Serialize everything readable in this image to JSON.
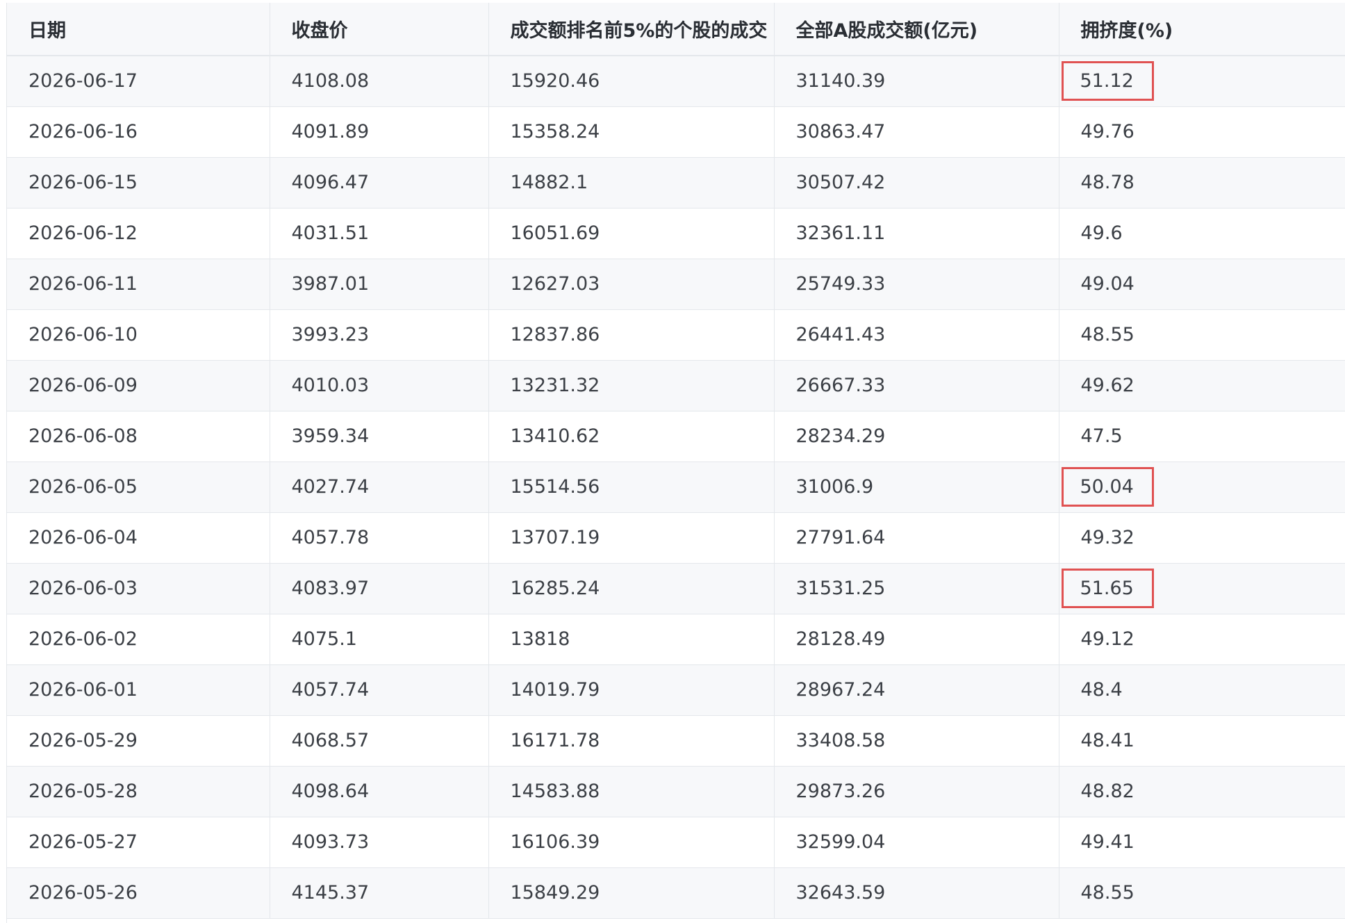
{
  "columns": [
    "日期",
    "收盘价",
    "成交额排名前5%的个股的成交",
    "全部A股成交额(亿元)",
    "拥挤度(%)"
  ],
  "rows": [
    {
      "date": "2026-06-17",
      "close": "4108.08",
      "top5": "15920.46",
      "total": "31140.39",
      "crowd": "51.12",
      "highlight": true
    },
    {
      "date": "2026-06-16",
      "close": "4091.89",
      "top5": "15358.24",
      "total": "30863.47",
      "crowd": "49.76",
      "highlight": false
    },
    {
      "date": "2026-06-15",
      "close": "4096.47",
      "top5": "14882.1",
      "total": "30507.42",
      "crowd": "48.78",
      "highlight": false
    },
    {
      "date": "2026-06-12",
      "close": "4031.51",
      "top5": "16051.69",
      "total": "32361.11",
      "crowd": "49.6",
      "highlight": false
    },
    {
      "date": "2026-06-11",
      "close": "3987.01",
      "top5": "12627.03",
      "total": "25749.33",
      "crowd": "49.04",
      "highlight": false
    },
    {
      "date": "2026-06-10",
      "close": "3993.23",
      "top5": "12837.86",
      "total": "26441.43",
      "crowd": "48.55",
      "highlight": false
    },
    {
      "date": "2026-06-09",
      "close": "4010.03",
      "top5": "13231.32",
      "total": "26667.33",
      "crowd": "49.62",
      "highlight": false
    },
    {
      "date": "2026-06-08",
      "close": "3959.34",
      "top5": "13410.62",
      "total": "28234.29",
      "crowd": "47.5",
      "highlight": false
    },
    {
      "date": "2026-06-05",
      "close": "4027.74",
      "top5": "15514.56",
      "total": "31006.9",
      "crowd": "50.04",
      "highlight": true
    },
    {
      "date": "2026-06-04",
      "close": "4057.78",
      "top5": "13707.19",
      "total": "27791.64",
      "crowd": "49.32",
      "highlight": false
    },
    {
      "date": "2026-06-03",
      "close": "4083.97",
      "top5": "16285.24",
      "total": "31531.25",
      "crowd": "51.65",
      "highlight": true
    },
    {
      "date": "2026-06-02",
      "close": "4075.1",
      "top5": "13818",
      "total": "28128.49",
      "crowd": "49.12",
      "highlight": false
    },
    {
      "date": "2026-06-01",
      "close": "4057.74",
      "top5": "14019.79",
      "total": "28967.24",
      "crowd": "48.4",
      "highlight": false
    },
    {
      "date": "2026-05-29",
      "close": "4068.57",
      "top5": "16171.78",
      "total": "33408.58",
      "crowd": "48.41",
      "highlight": false
    },
    {
      "date": "2026-05-28",
      "close": "4098.64",
      "top5": "14583.88",
      "total": "29873.26",
      "crowd": "48.82",
      "highlight": false
    },
    {
      "date": "2026-05-27",
      "close": "4093.73",
      "top5": "16106.39",
      "total": "32599.04",
      "crowd": "49.41",
      "highlight": false
    },
    {
      "date": "2026-05-26",
      "close": "4145.37",
      "top5": "15849.29",
      "total": "32643.59",
      "crowd": "48.55",
      "highlight": false
    }
  ],
  "colors": {
    "highlight": "#e05252",
    "grid": "#e4e7eb",
    "header_bg": "#f7f8fa"
  }
}
